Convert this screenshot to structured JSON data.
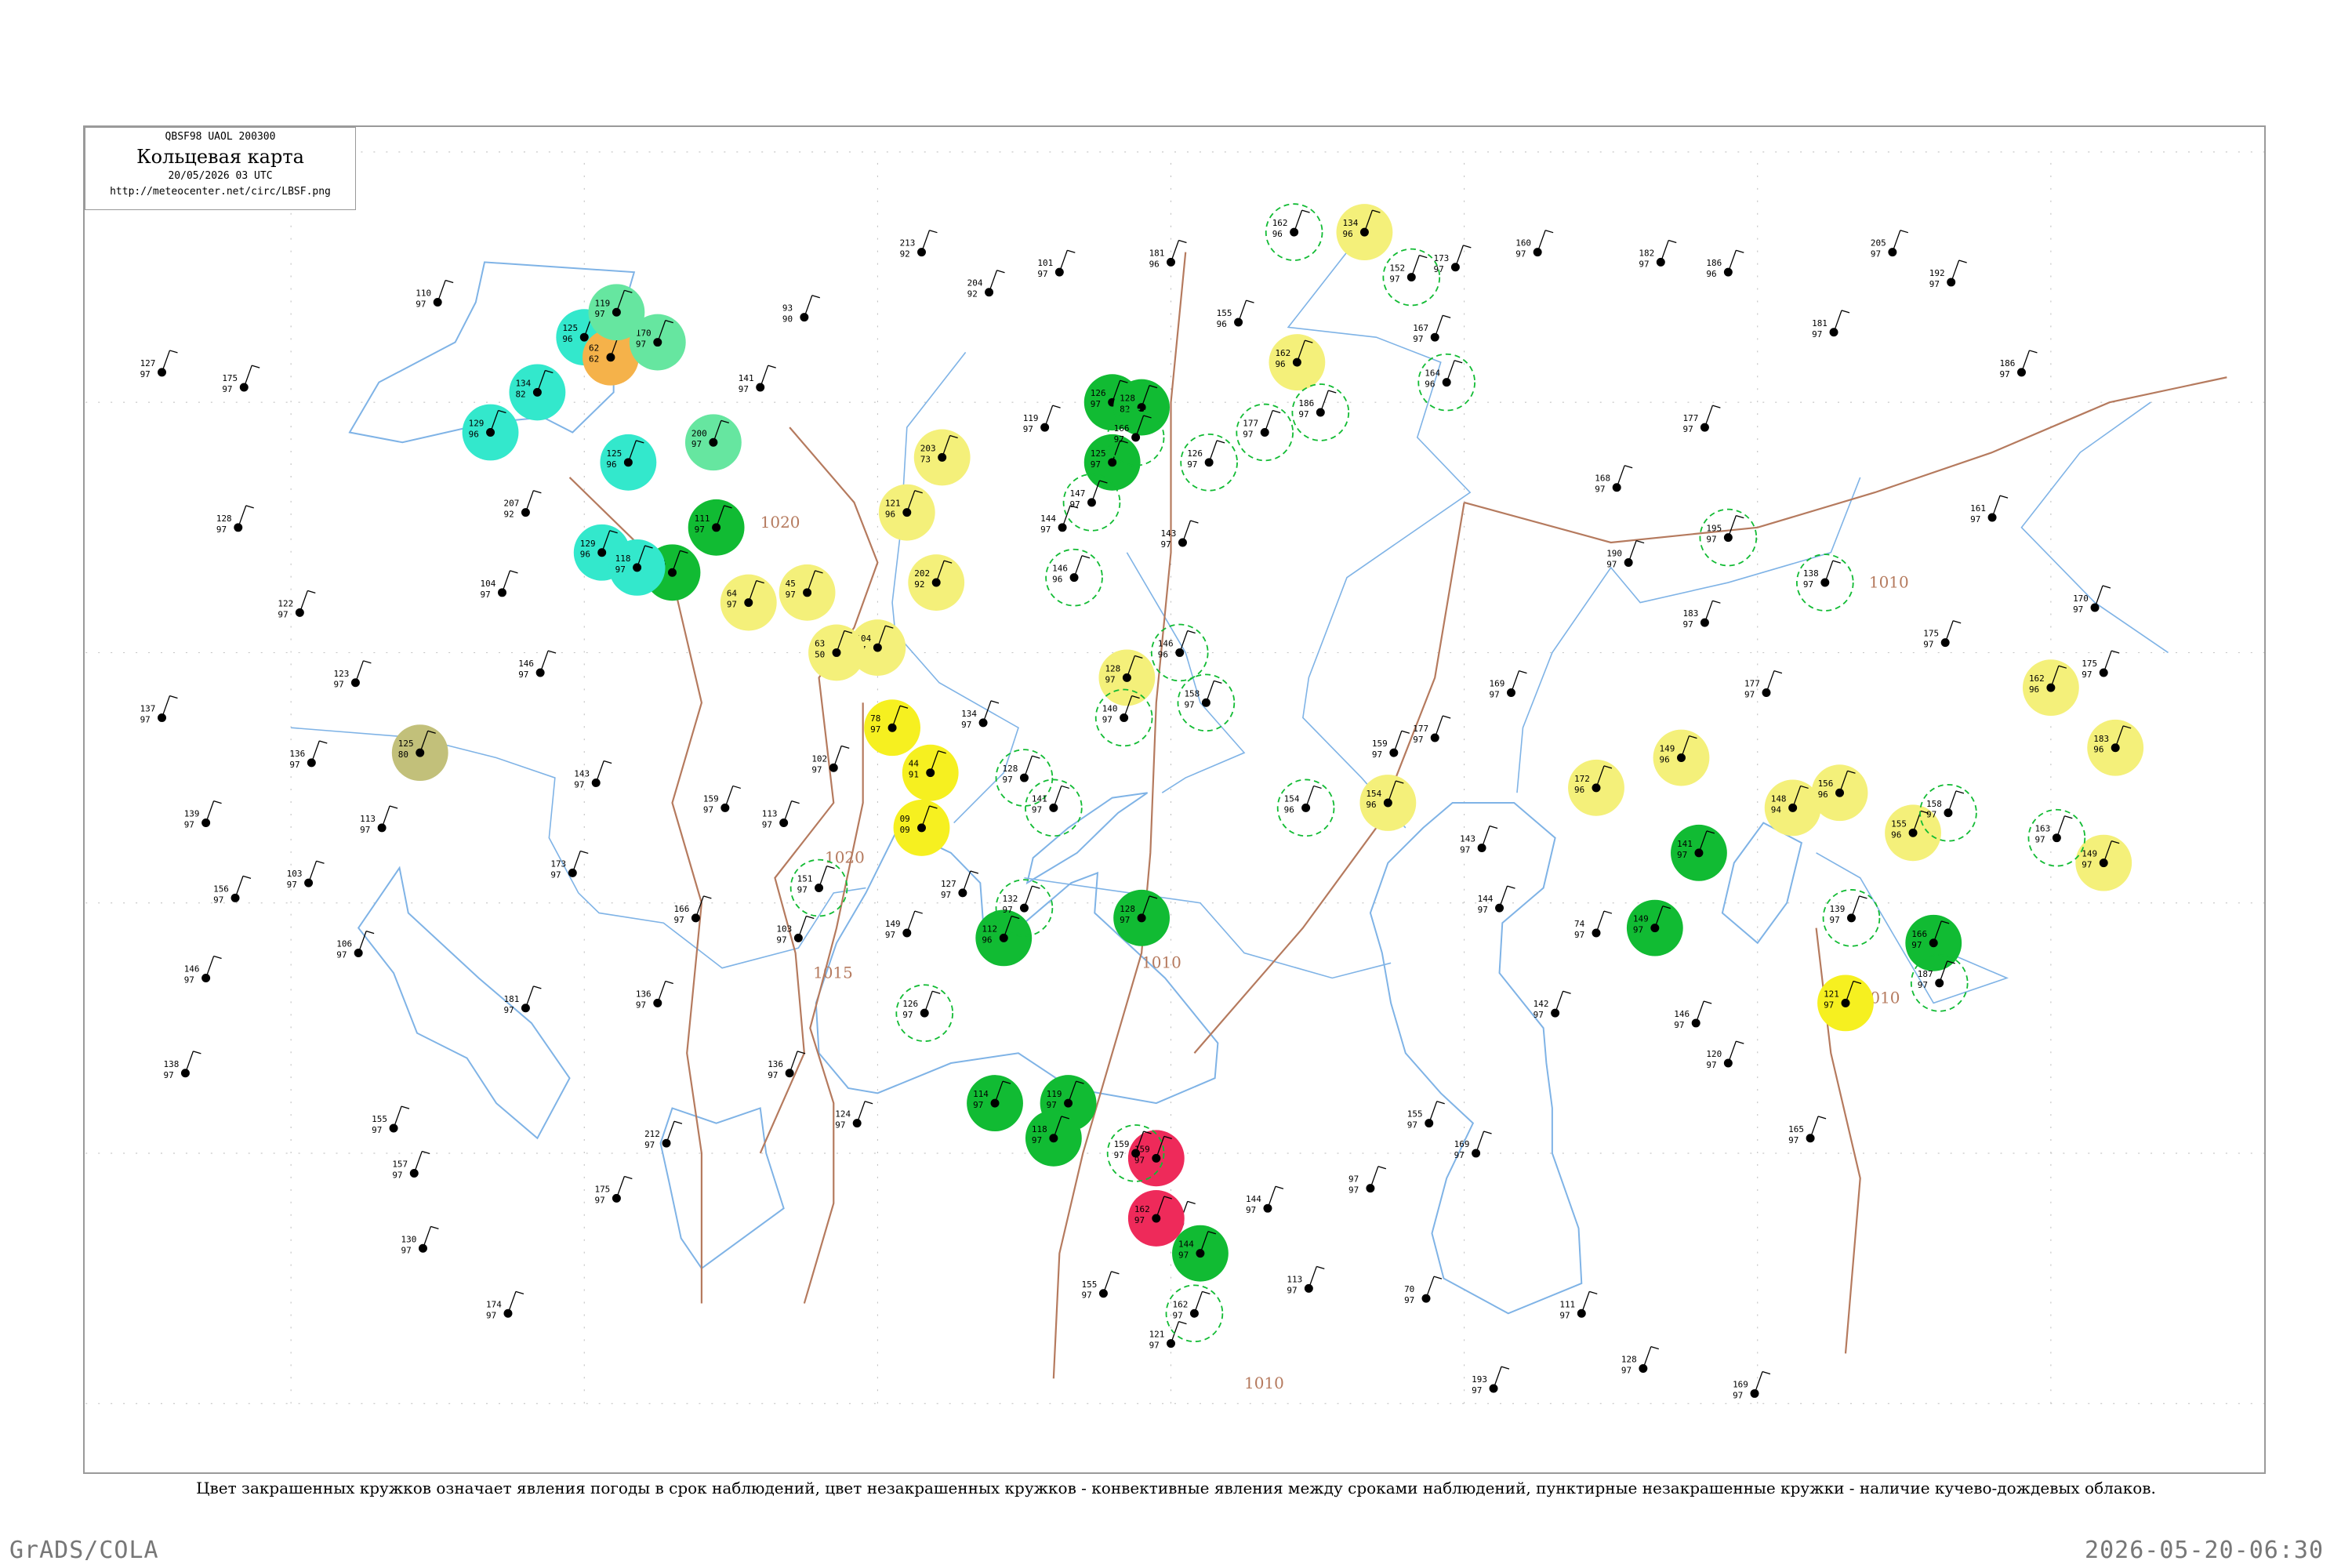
{
  "title": {
    "code": "QBSF98  UAOL  200300",
    "main": "Кольцевая карта",
    "date": "20/05/2026 03 UTC",
    "url": "http://meteocenter.net/circ/LBSF.png"
  },
  "caption": "Цвет закрашенных кружков означает явления погоды в срок наблюдений, цвет незакрашенных кружков - конвективные явления между сроками наблюдений, пунктирные незакрашенные кружки - наличие кучево-дождевых облаков.",
  "footer": {
    "left": "GrADS/COLA",
    "right": "2026-05-20-06:30"
  },
  "colors": {
    "coast": "#7fb3e6",
    "isobar": "#b57a5e",
    "green": "#11bb33",
    "yellow": "#f4f07a",
    "bright_yellow": "#f6f020",
    "red": "#ee2a5a",
    "cyan": "#33e8cc",
    "orange": "#f5b24a",
    "olive": "#c2c07a",
    "light_green": "#66e6a0"
  },
  "isobars": [
    {
      "label": "1020"
    },
    {
      "label": "1020"
    },
    {
      "label": "1015"
    },
    {
      "label": "1010"
    },
    {
      "label": "1010"
    },
    {
      "label": "1010"
    },
    {
      "label": "1010"
    }
  ],
  "stations": [
    {
      "kind": "filled",
      "color": "green",
      "lat": 55.0,
      "lon": 38.0,
      "t": "126",
      "d": "97"
    },
    {
      "kind": "filled",
      "color": "green",
      "lat": 54.9,
      "lon": 39.0,
      "t": "128",
      "d": "82"
    },
    {
      "kind": "filled",
      "color": "green",
      "lat": 53.8,
      "lon": 38.0,
      "t": "125",
      "d": "97"
    },
    {
      "kind": "filled",
      "color": "green",
      "lat": 52.5,
      "lon": 24.5,
      "t": "111",
      "d": "97"
    },
    {
      "kind": "filled",
      "color": "green",
      "lat": 51.6,
      "lon": 23.0,
      "t": "116",
      "d": "97"
    },
    {
      "kind": "filled",
      "color": "green",
      "lat": 44.3,
      "lon": 34.3,
      "t": "112",
      "d": "96"
    },
    {
      "kind": "filled",
      "color": "green",
      "lat": 44.7,
      "lon": 39.0,
      "t": "128",
      "d": "97"
    },
    {
      "kind": "filled",
      "color": "green",
      "lat": 46.0,
      "lon": 58.0,
      "t": "141",
      "d": "97"
    },
    {
      "kind": "filled",
      "color": "green",
      "lat": 44.5,
      "lon": 56.5,
      "t": "149",
      "d": "97"
    },
    {
      "kind": "filled",
      "color": "green",
      "lat": 44.2,
      "lon": 66.0,
      "t": "166",
      "d": "97"
    },
    {
      "kind": "filled",
      "color": "green",
      "lat": 41.0,
      "lon": 34.0,
      "t": "114",
      "d": "97"
    },
    {
      "kind": "filled",
      "color": "green",
      "lat": 41.0,
      "lon": 36.5,
      "t": "119",
      "d": "97"
    },
    {
      "kind": "filled",
      "color": "green",
      "lat": 40.3,
      "lon": 36.0,
      "t": "118",
      "d": "97"
    },
    {
      "kind": "filled",
      "color": "green",
      "lat": 38.0,
      "lon": 41.0,
      "t": "144",
      "d": "97"
    },
    {
      "kind": "filled",
      "color": "red",
      "lat": 39.9,
      "lon": 39.5,
      "t": "159",
      "d": "97"
    },
    {
      "kind": "filled",
      "color": "red",
      "lat": 38.7,
      "lon": 39.5,
      "t": "162",
      "d": "97"
    },
    {
      "kind": "filled",
      "color": "yellow",
      "lat": 50.1,
      "lon": 30.0,
      "t": "104",
      "d": "97"
    },
    {
      "kind": "filled",
      "color": "yellow",
      "lat": 51.4,
      "lon": 32.0,
      "t": "202",
      "d": "92"
    },
    {
      "kind": "filled",
      "color": "yellow",
      "lat": 53.9,
      "lon": 32.2,
      "t": "203",
      "d": "73"
    },
    {
      "kind": "filled",
      "color": "yellow",
      "lat": 49.5,
      "lon": 38.5,
      "t": "128",
      "d": "97"
    },
    {
      "kind": "filled",
      "color": "yellow",
      "lat": 52.8,
      "lon": 31.0,
      "t": "121",
      "d": "96"
    },
    {
      "kind": "filled",
      "color": "bright_yellow",
      "lat": 48.5,
      "lon": 30.5,
      "t": "78",
      "d": "97"
    },
    {
      "kind": "filled",
      "color": "bright_yellow",
      "lat": 47.6,
      "lon": 31.8,
      "t": "44",
      "d": "91"
    },
    {
      "kind": "filled",
      "color": "bright_yellow",
      "lat": 46.5,
      "lon": 31.5,
      "t": "09",
      "d": "09"
    },
    {
      "kind": "filled",
      "color": "bright_yellow",
      "lat": 43.0,
      "lon": 63.0,
      "t": "121",
      "d": "97"
    },
    {
      "kind": "filled",
      "color": "yellow",
      "lat": 47.9,
      "lon": 57.4,
      "t": "149",
      "d": "96"
    },
    {
      "kind": "filled",
      "color": "yellow",
      "lat": 47.2,
      "lon": 62.8,
      "t": "156",
      "d": "96"
    },
    {
      "kind": "filled",
      "color": "yellow",
      "lat": 46.9,
      "lon": 61.2,
      "t": "148",
      "d": "94"
    },
    {
      "kind": "filled",
      "color": "yellow",
      "lat": 46.4,
      "lon": 65.3,
      "t": "155",
      "d": "96"
    },
    {
      "kind": "filled",
      "color": "yellow",
      "lat": 47.3,
      "lon": 54.5,
      "t": "172",
      "d": "96"
    },
    {
      "kind": "filled",
      "color": "yellow",
      "lat": 47.0,
      "lon": 47.4,
      "t": "154",
      "d": "96"
    },
    {
      "kind": "filled",
      "color": "yellow",
      "lat": 49.3,
      "lon": 70.0,
      "t": "162",
      "d": "96"
    },
    {
      "kind": "filled",
      "color": "yellow",
      "lat": 48.1,
      "lon": 72.2,
      "t": "183",
      "d": "96"
    },
    {
      "kind": "filled",
      "color": "yellow",
      "lat": 45.8,
      "lon": 71.8,
      "t": "149",
      "d": "97"
    },
    {
      "kind": "filled",
      "color": "yellow",
      "lat": 58.4,
      "lon": 46.6,
      "t": "134",
      "d": "96"
    },
    {
      "kind": "filled",
      "color": "yellow",
      "lat": 55.8,
      "lon": 44.3,
      "t": "162",
      "d": "96"
    },
    {
      "kind": "filled",
      "color": "yellow",
      "lat": 51.0,
      "lon": 25.6,
      "t": "64",
      "d": "97"
    },
    {
      "kind": "filled",
      "color": "yellow",
      "lat": 51.2,
      "lon": 27.6,
      "t": "45",
      "d": "97"
    },
    {
      "kind": "filled",
      "color": "yellow",
      "lat": 50.0,
      "lon": 28.6,
      "t": "63",
      "d": "50"
    },
    {
      "kind": "filled",
      "color": "cyan",
      "lat": 53.8,
      "lon": 21.5,
      "t": "125",
      "d": "96"
    },
    {
      "kind": "filled",
      "color": "cyan",
      "lat": 54.4,
      "lon": 16.8,
      "t": "129",
      "d": "96"
    },
    {
      "kind": "filled",
      "color": "cyan",
      "lat": 55.2,
      "lon": 18.4,
      "t": "134",
      "d": "82"
    },
    {
      "kind": "filled",
      "color": "cyan",
      "lat": 52.0,
      "lon": 20.6,
      "t": "129",
      "d": "96"
    },
    {
      "kind": "filled",
      "color": "cyan",
      "lat": 56.3,
      "lon": 20.0,
      "t": "125",
      "d": "96"
    },
    {
      "kind": "filled",
      "color": "cyan",
      "lat": 51.7,
      "lon": 21.8,
      "t": "118",
      "d": "97"
    },
    {
      "kind": "filled",
      "color": "orange",
      "lat": 55.9,
      "lon": 20.9,
      "t": "62",
      "d": "62"
    },
    {
      "kind": "filled",
      "color": "light_green",
      "lat": 56.2,
      "lon": 22.5,
      "t": "170",
      "d": "97"
    },
    {
      "kind": "filled",
      "color": "light_green",
      "lat": 54.2,
      "lon": 24.4,
      "t": "200",
      "d": "97"
    },
    {
      "kind": "filled",
      "color": "light_green",
      "lat": 56.8,
      "lon": 21.1,
      "t": "119",
      "d": "97"
    },
    {
      "kind": "filled",
      "color": "olive",
      "lat": 48.0,
      "lon": 14.4,
      "t": "125",
      "d": "80"
    },
    {
      "kind": "dashed",
      "lat": 54.3,
      "lon": 38.8,
      "t": "166",
      "d": "97"
    },
    {
      "kind": "dashed",
      "lat": 53.8,
      "lon": 41.3,
      "t": "126",
      "d": "97"
    },
    {
      "kind": "dashed",
      "lat": 54.4,
      "lon": 43.2,
      "t": "177",
      "d": "97"
    },
    {
      "kind": "dashed",
      "lat": 54.8,
      "lon": 45.1,
      "t": "186",
      "d": "97"
    },
    {
      "kind": "dashed",
      "lat": 55.4,
      "lon": 49.4,
      "t": "164",
      "d": "96"
    },
    {
      "kind": "dashed",
      "lat": 53.0,
      "lon": 37.3,
      "t": "147",
      "d": "97"
    },
    {
      "kind": "dashed",
      "lat": 51.5,
      "lon": 36.7,
      "t": "146",
      "d": "96"
    },
    {
      "kind": "dashed",
      "lat": 50.0,
      "lon": 40.3,
      "t": "146",
      "d": "96"
    },
    {
      "kind": "dashed",
      "lat": 48.7,
      "lon": 38.4,
      "t": "140",
      "d": "97"
    },
    {
      "kind": "dashed",
      "lat": 49.0,
      "lon": 41.2,
      "t": "158",
      "d": "97"
    },
    {
      "kind": "dashed",
      "lat": 47.5,
      "lon": 35.0,
      "t": "128",
      "d": "97"
    },
    {
      "kind": "dashed",
      "lat": 46.9,
      "lon": 36.0,
      "t": "141",
      "d": "97"
    },
    {
      "kind": "dashed",
      "lat": 45.3,
      "lon": 28.0,
      "t": "151",
      "d": "97"
    },
    {
      "kind": "dashed",
      "lat": 44.9,
      "lon": 35.0,
      "t": "132",
      "d": "97"
    },
    {
      "kind": "dashed",
      "lat": 42.8,
      "lon": 31.6,
      "t": "126",
      "d": "97"
    },
    {
      "kind": "dashed",
      "lat": 57.5,
      "lon": 48.2,
      "t": "152",
      "d": "97"
    },
    {
      "kind": "dashed",
      "lat": 58.4,
      "lon": 44.2,
      "t": "162",
      "d": "96"
    },
    {
      "kind": "dashed",
      "lat": 52.3,
      "lon": 59.0,
      "t": "195",
      "d": "97"
    },
    {
      "kind": "dashed",
      "lat": 51.4,
      "lon": 62.3,
      "t": "138",
      "d": "97"
    },
    {
      "kind": "dashed",
      "lat": 46.8,
      "lon": 66.5,
      "t": "158",
      "d": "97"
    },
    {
      "kind": "dashed",
      "lat": 44.7,
      "lon": 63.2,
      "t": "139",
      "d": "97"
    },
    {
      "kind": "dashed",
      "lat": 43.4,
      "lon": 66.2,
      "t": "187",
      "d": "97"
    },
    {
      "kind": "dashed",
      "lat": 46.3,
      "lon": 70.2,
      "t": "163",
      "d": "97"
    },
    {
      "kind": "dashed",
      "lat": 46.9,
      "lon": 44.6,
      "t": "154",
      "d": "96"
    },
    {
      "kind": "dashed",
      "lat": 40.0,
      "lon": 38.8,
      "t": "159",
      "d": "97"
    },
    {
      "kind": "dashed",
      "lat": 36.8,
      "lon": 40.8,
      "t": "162",
      "d": "97"
    }
  ],
  "plain_stations": [
    {
      "lat": 57.0,
      "lon": 15.0,
      "t": "110",
      "d": "97"
    },
    {
      "lat": 55.3,
      "lon": 26.0,
      "t": "141",
      "d": "97"
    },
    {
      "lat": 56.7,
      "lon": 27.5,
      "t": "93",
      "d": "90"
    },
    {
      "lat": 58.0,
      "lon": 31.5,
      "t": "213",
      "d": "92"
    },
    {
      "lat": 57.2,
      "lon": 33.8,
      "t": "204",
      "d": "92"
    },
    {
      "lat": 57.6,
      "lon": 36.2,
      "t": "101",
      "d": "97"
    },
    {
      "lat": 54.5,
      "lon": 35.7,
      "t": "119",
      "d": "97"
    },
    {
      "lat": 52.5,
      "lon": 36.3,
      "t": "144",
      "d": "97"
    },
    {
      "lat": 52.2,
      "lon": 40.4,
      "t": "143",
      "d": "97"
    },
    {
      "lat": 57.8,
      "lon": 40.0,
      "t": "181",
      "d": "96"
    },
    {
      "lat": 56.6,
      "lon": 42.3,
      "t": "155",
      "d": "96"
    },
    {
      "lat": 56.3,
      "lon": 49.0,
      "t": "167",
      "d": "97"
    },
    {
      "lat": 57.7,
      "lon": 49.7,
      "t": "173",
      "d": "97"
    },
    {
      "lat": 58.0,
      "lon": 52.5,
      "t": "160",
      "d": "97"
    },
    {
      "lat": 57.8,
      "lon": 56.7,
      "t": "182",
      "d": "97"
    },
    {
      "lat": 57.6,
      "lon": 59.0,
      "t": "186",
      "d": "96"
    },
    {
      "lat": 56.4,
      "lon": 62.6,
      "t": "181",
      "d": "97"
    },
    {
      "lat": 58.0,
      "lon": 64.6,
      "t": "205",
      "d": "97"
    },
    {
      "lat": 57.4,
      "lon": 66.6,
      "t": "192",
      "d": "97"
    },
    {
      "lat": 55.6,
      "lon": 69.0,
      "t": "186",
      "d": "97"
    },
    {
      "lat": 54.5,
      "lon": 58.2,
      "t": "177",
      "d": "97"
    },
    {
      "lat": 53.3,
      "lon": 55.2,
      "t": "168",
      "d": "97"
    },
    {
      "lat": 51.8,
      "lon": 55.6,
      "t": "190",
      "d": "97"
    },
    {
      "lat": 50.6,
      "lon": 58.2,
      "t": "183",
      "d": "97"
    },
    {
      "lat": 49.2,
      "lon": 60.3,
      "t": "177",
      "d": "97"
    },
    {
      "lat": 50.2,
      "lon": 66.4,
      "t": "175",
      "d": "97"
    },
    {
      "lat": 52.7,
      "lon": 68.0,
      "t": "161",
      "d": "97"
    },
    {
      "lat": 50.9,
      "lon": 71.5,
      "t": "170",
      "d": "97"
    },
    {
      "lat": 49.6,
      "lon": 71.8,
      "t": "175",
      "d": "97"
    },
    {
      "lat": 48.3,
      "lon": 49.0,
      "t": "177",
      "d": "97"
    },
    {
      "lat": 48.0,
      "lon": 47.6,
      "t": "159",
      "d": "97"
    },
    {
      "lat": 49.2,
      "lon": 51.6,
      "t": "169",
      "d": "97"
    },
    {
      "lat": 46.1,
      "lon": 50.6,
      "t": "143",
      "d": "97"
    },
    {
      "lat": 44.9,
      "lon": 51.2,
      "t": "144",
      "d": "97"
    },
    {
      "lat": 44.4,
      "lon": 54.5,
      "t": "74",
      "d": "97"
    },
    {
      "lat": 42.8,
      "lon": 53.1,
      "t": "142",
      "d": "97"
    },
    {
      "lat": 42.6,
      "lon": 57.9,
      "t": "146",
      "d": "97"
    },
    {
      "lat": 41.8,
      "lon": 59.0,
      "t": "120",
      "d": "97"
    },
    {
      "lat": 40.3,
      "lon": 61.8,
      "t": "165",
      "d": "97"
    },
    {
      "lat": 40.6,
      "lon": 48.8,
      "t": "155",
      "d": "97"
    },
    {
      "lat": 40.0,
      "lon": 50.4,
      "t": "169",
      "d": "97"
    },
    {
      "lat": 39.3,
      "lon": 46.8,
      "t": "97",
      "d": "97"
    },
    {
      "lat": 38.9,
      "lon": 43.3,
      "t": "144",
      "d": "97"
    },
    {
      "lat": 37.3,
      "lon": 44.7,
      "t": "113",
      "d": "97"
    },
    {
      "lat": 37.1,
      "lon": 48.7,
      "t": "70",
      "d": "97"
    },
    {
      "lat": 36.8,
      "lon": 54.0,
      "t": "111",
      "d": "97"
    },
    {
      "lat": 35.7,
      "lon": 56.1,
      "t": "128",
      "d": "97"
    },
    {
      "lat": 35.2,
      "lon": 59.9,
      "t": "169",
      "d": "97"
    },
    {
      "lat": 35.3,
      "lon": 51.0,
      "t": "193",
      "d": "97"
    },
    {
      "lat": 36.2,
      "lon": 40.0,
      "t": "121",
      "d": "97"
    },
    {
      "lat": 37.2,
      "lon": 37.7,
      "t": "155",
      "d": "97"
    },
    {
      "lat": 38.6,
      "lon": 40.3,
      "t": "123",
      "d": "97"
    },
    {
      "lat": 40.6,
      "lon": 29.3,
      "t": "124",
      "d": "97"
    },
    {
      "lat": 41.6,
      "lon": 27.0,
      "t": "136",
      "d": "97"
    },
    {
      "lat": 43.0,
      "lon": 22.5,
      "t": "136",
      "d": "97"
    },
    {
      "lat": 44.7,
      "lon": 23.8,
      "t": "166",
      "d": "97"
    },
    {
      "lat": 46.9,
      "lon": 24.8,
      "t": "159",
      "d": "97"
    },
    {
      "lat": 47.4,
      "lon": 20.4,
      "t": "143",
      "d": "97"
    },
    {
      "lat": 49.6,
      "lon": 18.5,
      "t": "146",
      "d": "97"
    },
    {
      "lat": 51.2,
      "lon": 17.2,
      "t": "104",
      "d": "97"
    },
    {
      "lat": 52.8,
      "lon": 18.0,
      "t": "207",
      "d": "92"
    },
    {
      "lat": 45.4,
      "lon": 10.6,
      "t": "103",
      "d": "97"
    },
    {
      "lat": 44.0,
      "lon": 12.3,
      "t": "106",
      "d": "97"
    },
    {
      "lat": 46.5,
      "lon": 13.1,
      "t": "113",
      "d": "97"
    },
    {
      "lat": 47.8,
      "lon": 10.7,
      "t": "136",
      "d": "97"
    },
    {
      "lat": 49.4,
      "lon": 12.2,
      "t": "123",
      "d": "97"
    },
    {
      "lat": 50.8,
      "lon": 10.3,
      "t": "122",
      "d": "97"
    },
    {
      "lat": 52.5,
      "lon": 8.2,
      "t": "128",
      "d": "97"
    },
    {
      "lat": 55.6,
      "lon": 5.6,
      "t": "127",
      "d": "97"
    },
    {
      "lat": 55.3,
      "lon": 8.4,
      "t": "175",
      "d": "97"
    },
    {
      "lat": 48.7,
      "lon": 5.6,
      "t": "137",
      "d": "97"
    },
    {
      "lat": 46.6,
      "lon": 7.1,
      "t": "139",
      "d": "97"
    },
    {
      "lat": 45.1,
      "lon": 8.1,
      "t": "156",
      "d": "97"
    },
    {
      "lat": 43.5,
      "lon": 7.1,
      "t": "146",
      "d": "97"
    },
    {
      "lat": 41.6,
      "lon": 6.4,
      "t": "138",
      "d": "97"
    },
    {
      "lat": 40.5,
      "lon": 13.5,
      "t": "155",
      "d": "97"
    },
    {
      "lat": 39.6,
      "lon": 14.2,
      "t": "157",
      "d": "97"
    },
    {
      "lat": 38.1,
      "lon": 14.5,
      "t": "130",
      "d": "97"
    },
    {
      "lat": 36.8,
      "lon": 17.4,
      "t": "174",
      "d": "97"
    },
    {
      "lat": 39.1,
      "lon": 21.1,
      "t": "175",
      "d": "97"
    },
    {
      "lat": 40.2,
      "lon": 22.8,
      "t": "212",
      "d": "97"
    },
    {
      "lat": 42.9,
      "lon": 18.0,
      "t": "181",
      "d": "97"
    },
    {
      "lat": 45.6,
      "lon": 19.6,
      "t": "173",
      "d": "97"
    },
    {
      "lat": 47.7,
      "lon": 28.5,
      "t": "102",
      "d": "97"
    },
    {
      "lat": 46.6,
      "lon": 26.8,
      "t": "113",
      "d": "97"
    },
    {
      "lat": 44.3,
      "lon": 27.3,
      "t": "103",
      "d": "97"
    },
    {
      "lat": 48.6,
      "lon": 33.6,
      "t": "134",
      "d": "97"
    },
    {
      "lat": 45.2,
      "lon": 32.9,
      "t": "127",
      "d": "97"
    },
    {
      "lat": 44.4,
      "lon": 31.0,
      "t": "149",
      "d": "97"
    }
  ]
}
